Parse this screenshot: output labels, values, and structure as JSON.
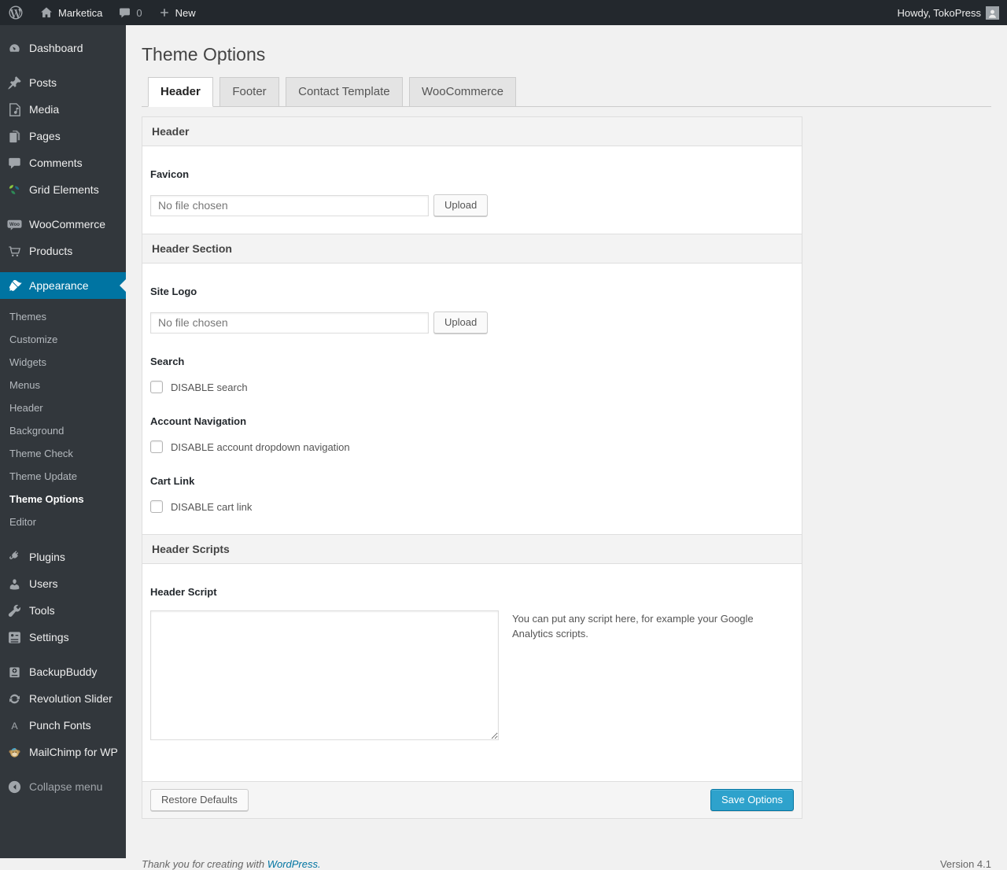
{
  "admin_bar": {
    "site_name": "Marketica",
    "comment_count": "0",
    "new_label": "New",
    "howdy": "Howdy, TokoPress"
  },
  "sidebar": {
    "items": [
      {
        "label": "Dashboard",
        "icon": "dashboard-icon"
      },
      {
        "label": "Posts",
        "icon": "pushpin-icon"
      },
      {
        "label": "Media",
        "icon": "media-icon"
      },
      {
        "label": "Pages",
        "icon": "pages-icon"
      },
      {
        "label": "Comments",
        "icon": "comment-icon"
      },
      {
        "label": "Grid Elements",
        "icon": "grid-elements-icon"
      },
      {
        "label": "WooCommerce",
        "icon": "woocommerce-icon"
      },
      {
        "label": "Products",
        "icon": "cart-icon"
      },
      {
        "label": "Appearance",
        "icon": "brush-icon",
        "active": true
      },
      {
        "label": "Plugins",
        "icon": "plug-icon"
      },
      {
        "label": "Users",
        "icon": "user-icon"
      },
      {
        "label": "Tools",
        "icon": "wrench-icon"
      },
      {
        "label": "Settings",
        "icon": "settings-icon"
      },
      {
        "label": "BackupBuddy",
        "icon": "backup-icon"
      },
      {
        "label": "Revolution Slider",
        "icon": "refresh-icon"
      },
      {
        "label": "Punch Fonts",
        "icon": "letter-a-icon"
      },
      {
        "label": "MailChimp for WP",
        "icon": "monkey-icon"
      }
    ],
    "appearance_submenu": [
      "Themes",
      "Customize",
      "Widgets",
      "Menus",
      "Header",
      "Background",
      "Theme Check",
      "Theme Update",
      "Theme Options",
      "Editor"
    ],
    "current_submenu_item": "Theme Options",
    "collapse_label": "Collapse menu"
  },
  "page": {
    "title": "Theme Options",
    "tabs": [
      {
        "label": "Header",
        "active": true
      },
      {
        "label": "Footer",
        "active": false
      },
      {
        "label": "Contact Template",
        "active": false
      },
      {
        "label": "WooCommerce",
        "active": false
      }
    ]
  },
  "panel": {
    "section_header": "Header",
    "favicon": {
      "label": "Favicon",
      "placeholder": "No file chosen",
      "upload_label": "Upload"
    },
    "section_header_section": "Header Section",
    "site_logo": {
      "label": "Site Logo",
      "placeholder": "No file chosen",
      "upload_label": "Upload"
    },
    "search": {
      "label": "Search",
      "checkbox_label": "DISABLE search",
      "checked": false
    },
    "account_navigation": {
      "label": "Account Navigation",
      "checkbox_label": "DISABLE account dropdown navigation",
      "checked": false
    },
    "cart_link": {
      "label": "Cart Link",
      "checkbox_label": "DISABLE cart link",
      "checked": false
    },
    "section_header_scripts": "Header Scripts",
    "header_script": {
      "label": "Header Script",
      "value": "",
      "hint": "You can put any script here, for example your Google Analytics scripts."
    },
    "restore_button_label": "Restore Defaults",
    "save_button_label": "Save Options"
  },
  "footer": {
    "thanks_text": "Thank you for creating with",
    "wordpress_link": "WordPress.",
    "version": "Version 4.1"
  },
  "colors": {
    "accent": "#0074a2",
    "primary_button": "#2ea2cc",
    "admin_bar_bg": "#23282d",
    "menu_bg": "#32373c",
    "page_bg": "#f1f1f1",
    "link": "#0074a2"
  }
}
